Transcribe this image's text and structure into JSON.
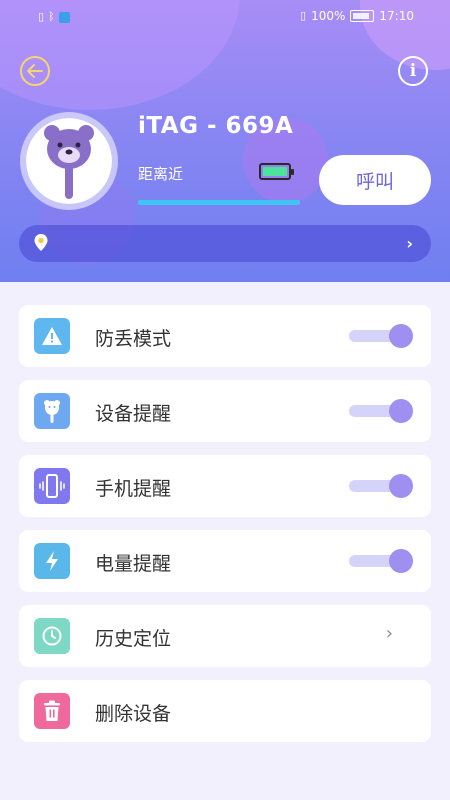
{
  "status_bar": {
    "time": "17:10",
    "battery_percent": "100%"
  },
  "header": {
    "device_name": "iTAG - 669A",
    "distance": "距离近",
    "call_button": "呼叫",
    "battery_level": 1.0,
    "signal_level": 1.0,
    "location": "",
    "colors": {
      "gradient_top": "#a88df6",
      "gradient_bottom": "#6f7ff0",
      "accent": "#6b66e6"
    }
  },
  "settings": [
    {
      "label": "防丢模式",
      "icon": "warning-icon",
      "color": "#5eb7ef",
      "control": "toggle",
      "on": true
    },
    {
      "label": "设备提醒",
      "icon": "bear-tag-icon",
      "color": "#6ea8f1",
      "control": "toggle",
      "on": true
    },
    {
      "label": "手机提醒",
      "icon": "phone-vibrate-icon",
      "color": "#8078ee",
      "control": "toggle",
      "on": true
    },
    {
      "label": "电量提醒",
      "icon": "lightning-icon",
      "color": "#5ab7ea",
      "control": "toggle",
      "on": true
    },
    {
      "label": "历史定位",
      "icon": "history-clock-icon",
      "color": "#7dd9c5",
      "control": "chevron"
    },
    {
      "label": "删除设备",
      "icon": "trash-icon",
      "color": "#f0699c",
      "control": "none"
    }
  ]
}
